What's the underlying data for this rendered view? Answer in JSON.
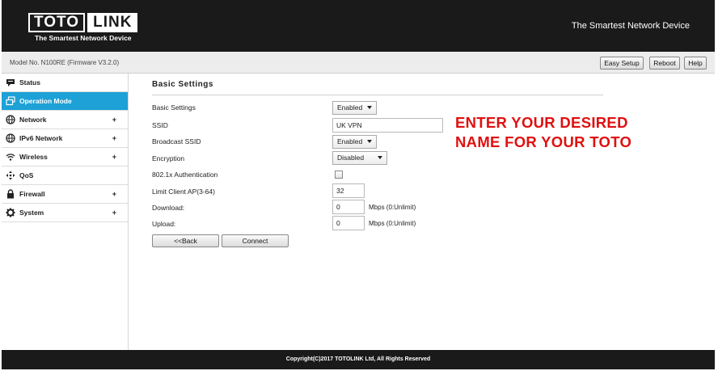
{
  "header": {
    "logo_left": "TOTO",
    "logo_right": "LINK",
    "logo_tagline": "The Smartest Network Device",
    "slogan": "The Smartest Network Device"
  },
  "modelbar": {
    "model_text": "Model No. N100RE (Firmware V3.2.0)",
    "buttons": {
      "easy_setup": "Easy Setup",
      "reboot": "Reboot",
      "help": "Help"
    }
  },
  "sidebar": {
    "items": [
      {
        "label": "Status",
        "icon": "status-icon",
        "expandable": false,
        "active": false
      },
      {
        "label": "Operation Mode",
        "icon": "operation-mode-icon",
        "expandable": false,
        "active": true
      },
      {
        "label": "Network",
        "icon": "network-globe-icon",
        "expandable": true,
        "active": false
      },
      {
        "label": "IPv6 Network",
        "icon": "ipv6-globe-icon",
        "expandable": true,
        "active": false
      },
      {
        "label": "Wireless",
        "icon": "wifi-icon",
        "expandable": true,
        "active": false
      },
      {
        "label": "QoS",
        "icon": "qos-icon",
        "expandable": false,
        "active": false
      },
      {
        "label": "Firewall",
        "icon": "lock-icon",
        "expandable": true,
        "active": false
      },
      {
        "label": "System",
        "icon": "gear-icon",
        "expandable": true,
        "active": false
      }
    ],
    "plus_symbol": "+"
  },
  "main": {
    "title": "Basic Settings",
    "fields": {
      "basic_settings": {
        "label": "Basic Settings",
        "value": "Enabled"
      },
      "ssid": {
        "label": "SSID",
        "value": "UK VPN"
      },
      "broadcast_ssid": {
        "label": "Broadcast SSID",
        "value": "Enabled"
      },
      "encryption": {
        "label": "Encryption",
        "value": "Disabled"
      },
      "auth_8021x": {
        "label": "802.1x Authentication",
        "checked": false
      },
      "limit_client": {
        "label": "Limit Client AP(3-64)",
        "value": "32"
      },
      "download": {
        "label": "Download:",
        "value": "0",
        "unit": "Mbps (0:Unlimit)"
      },
      "upload": {
        "label": "Upload:",
        "value": "0",
        "unit": "Mbps (0:Unlimit)"
      }
    },
    "buttons": {
      "back": "<<Back",
      "connect": "Connect"
    },
    "annotation": [
      "ENTER YOUR DESIRED",
      "NAME FOR YOUR TOTO"
    ]
  },
  "footer": {
    "copyright": "Copyright(C)2017 TOTOLINK Ltd, All Rights Reserved"
  },
  "colors": {
    "header_bg": "#1a1a1a",
    "active_nav": "#1da1d6",
    "annotation": "#e01010"
  }
}
